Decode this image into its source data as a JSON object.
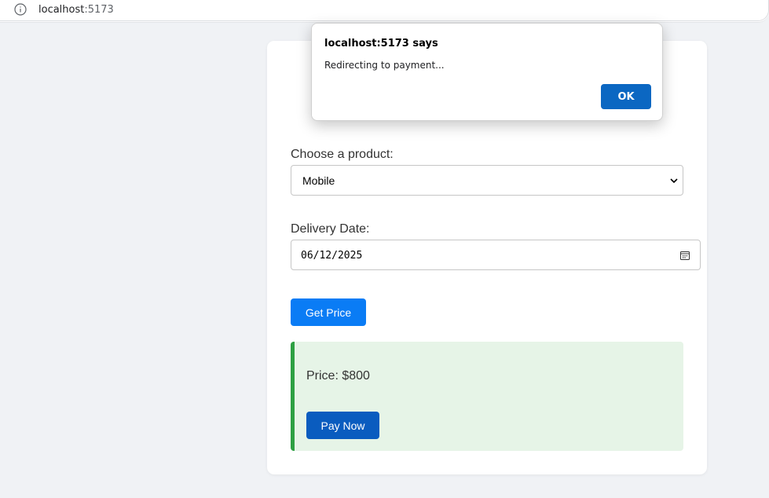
{
  "browser": {
    "url_host": "localhost",
    "url_port": ":5173",
    "info_icon": "info-icon"
  },
  "form": {
    "product_label": "Choose a product:",
    "product_selected": "Mobile",
    "date_label": "Delivery Date:",
    "date_value": "06/12/2025",
    "get_price_label": "Get Price"
  },
  "result": {
    "price_text": "Price: $800",
    "pay_now_label": "Pay Now"
  },
  "dialog": {
    "title": "localhost:5173 says",
    "message": "Redirecting to payment...",
    "ok_label": "OK"
  },
  "colors": {
    "primary_button": "#0a7cf5",
    "pay_button": "#0a5cbf",
    "result_bg": "#e6f4e7",
    "result_border": "#2ea043",
    "dialog_ok": "#0b67c2"
  }
}
